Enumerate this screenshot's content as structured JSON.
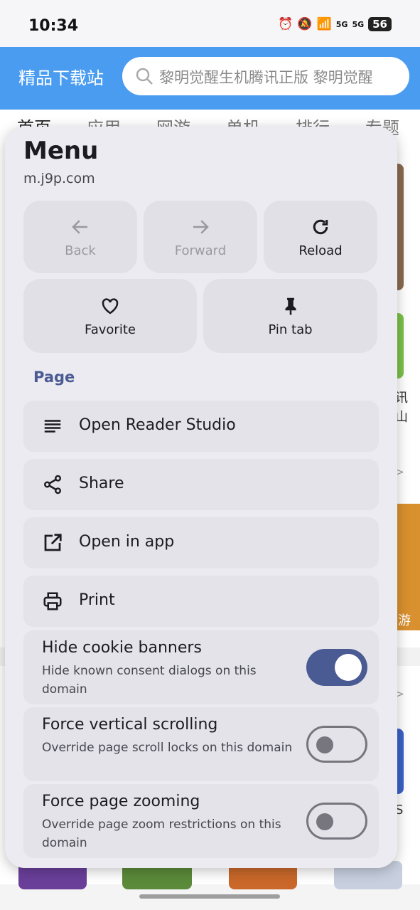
{
  "status_bar": {
    "time": "10:34",
    "signal1": "5G",
    "signal2": "5G",
    "battery": "56"
  },
  "site": {
    "logo": "精品下载站",
    "search_placeholder": "黎明觉醒生机腾讯正版 黎明觉醒",
    "tabs": [
      "首页",
      "应用",
      "网游",
      "单机",
      "排行",
      "专题"
    ],
    "fragments": [
      "讯",
      "山",
      ">",
      "游",
      ">",
      "S"
    ]
  },
  "menu": {
    "title": "Menu",
    "url": "m.j9p.com",
    "nav": {
      "back": "Back",
      "forward": "Forward",
      "reload": "Reload",
      "favorite": "Favorite",
      "pin_tab": "Pin tab"
    },
    "section_page": "Page",
    "items": [
      {
        "label": "Open Reader Studio",
        "icon": "reader-icon"
      },
      {
        "label": "Share",
        "icon": "share-icon"
      },
      {
        "label": "Open in app",
        "icon": "open-external-icon"
      },
      {
        "label": "Print",
        "icon": "print-icon"
      }
    ],
    "toggles": [
      {
        "title": "Hide cookie banners",
        "subtitle": "Hide known consent dialogs on this domain",
        "on": true
      },
      {
        "title": "Force vertical scrolling",
        "subtitle": "Override page scroll locks on this domain",
        "on": false
      },
      {
        "title": "Force page zooming",
        "subtitle": "Override page zoom restrictions on this domain",
        "on": false
      }
    ]
  },
  "colors": {
    "accent": "#4a5a92",
    "site_header": "#4a9cf0",
    "sheet_bg": "#ecebf1"
  }
}
